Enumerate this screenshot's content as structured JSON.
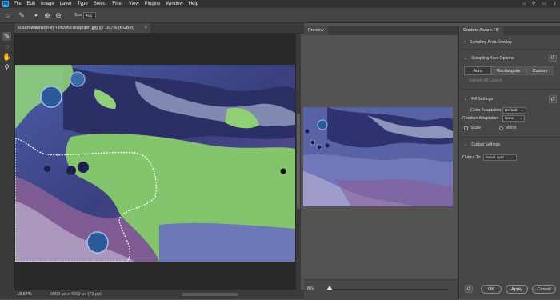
{
  "app": {
    "logo": "Ps"
  },
  "menubar": {
    "items": [
      "File",
      "Edit",
      "Image",
      "Layer",
      "Type",
      "Select",
      "Filter",
      "View",
      "Plugins",
      "Window",
      "Help"
    ],
    "right_icons": [
      "home-icon",
      "search-icon",
      "workspace-icon",
      "share-icon"
    ]
  },
  "options": {
    "size_label": "Size",
    "size_value": "400"
  },
  "document": {
    "tab_title": "susan-wilkinson-lryTiIh00os-unsplash.jpg @ 16.7% (RGB/8)",
    "close": "×"
  },
  "status": {
    "zoom": "16.67%",
    "info": "6000 px x 4000 px (72 ppi)"
  },
  "preview": {
    "tab": "Preview",
    "zoom": "8%"
  },
  "panel": {
    "title": "Content Aware Fill",
    "sampling_overlay": "Sampling Area Overlay",
    "sampling_options": "Sampling Area Options",
    "modes": [
      "Auto",
      "Rectangular",
      "Custom"
    ],
    "sample_all_layers": "Sample All Layers",
    "fill_settings": "Fill Settings",
    "color_adaptation_label": "Color Adaptation",
    "color_adaptation_value": "Default",
    "rotation_adaptation_label": "Rotation Adaptation",
    "rotation_adaptation_value": "None",
    "scale_label": "Scale",
    "mirror_label": "Mirror",
    "output_settings": "Output Settings",
    "output_to_label": "Output To",
    "output_to_value": "New Layer",
    "ok": "OK",
    "apply": "Apply",
    "cancel": "Cancel"
  }
}
